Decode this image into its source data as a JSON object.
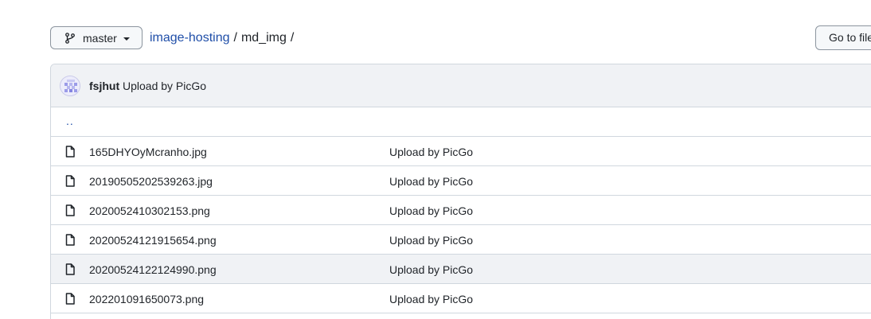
{
  "toolbar": {
    "branch_label": "master",
    "goto_label": "Go to file"
  },
  "breadcrumb": {
    "repo": "image-hosting",
    "separator": "/",
    "folder": "md_img",
    "trailing": "/"
  },
  "commit": {
    "author": "fsjhut",
    "message": "Upload by PicGo"
  },
  "up_link": "..",
  "files": [
    {
      "name": "165DHYOyMcranho.jpg",
      "message": "Upload by PicGo"
    },
    {
      "name": "20190505202539263.jpg",
      "message": "Upload by PicGo"
    },
    {
      "name": "2020052410302153.png",
      "message": "Upload by PicGo"
    },
    {
      "name": "20200524121915654.png",
      "message": "Upload by PicGo"
    },
    {
      "name": "20200524122124990.png",
      "message": "Upload by PicGo"
    },
    {
      "name": "202201091650073.png",
      "message": "Upload by PicGo"
    }
  ],
  "colors": {
    "link": "#1f4ea8",
    "row_highlight": "#f0f2f5",
    "border": "#d0d7de"
  }
}
